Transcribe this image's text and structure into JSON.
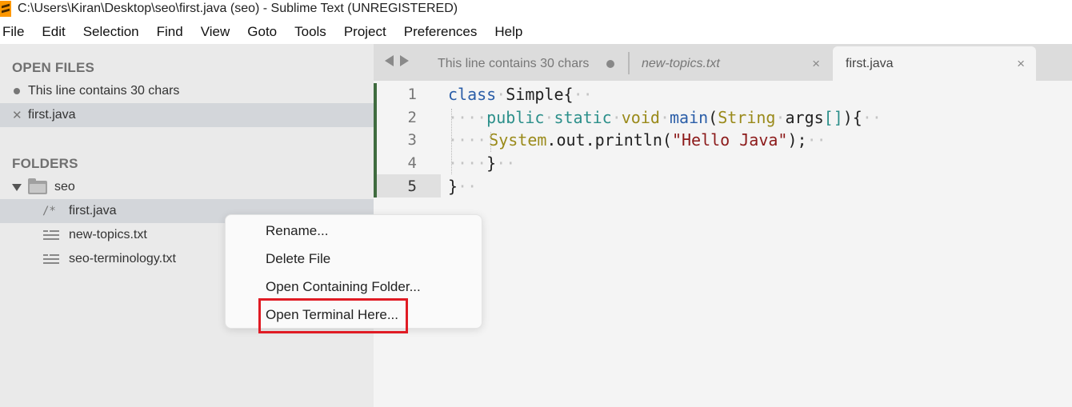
{
  "window": {
    "title": "C:\\Users\\Kiran\\Desktop\\seo\\first.java (seo) - Sublime Text (UNREGISTERED)"
  },
  "menubar": {
    "items": [
      "File",
      "Edit",
      "Selection",
      "Find",
      "View",
      "Goto",
      "Tools",
      "Project",
      "Preferences",
      "Help"
    ]
  },
  "sidebar": {
    "open_files_title": "OPEN FILES",
    "open_files": [
      {
        "label": "This line contains 30 chars",
        "state": "modified"
      },
      {
        "label": "first.java",
        "state": "active"
      }
    ],
    "folders_title": "FOLDERS",
    "folder": {
      "name": "seo",
      "expanded": true
    },
    "files": [
      {
        "glyph": "/*",
        "label": "first.java",
        "icon": "java-file-icon"
      },
      {
        "label": "new-topics.txt",
        "icon": "text-file-icon"
      },
      {
        "label": "seo-terminology.txt",
        "icon": "text-file-icon"
      }
    ]
  },
  "tabs": [
    {
      "label": "This line contains 30 chars",
      "dirty": true,
      "active": false
    },
    {
      "label": "new-topics.txt",
      "italic": true,
      "close": "×",
      "active": false
    },
    {
      "label": "first.java",
      "close": "×",
      "active": true
    }
  ],
  "editor": {
    "line_numbers": [
      "1",
      "2",
      "3",
      "4",
      "5"
    ],
    "current_line": 5,
    "code": {
      "l1_kw": "class",
      "l1_name": "Simple{",
      "l2_kw1": "public",
      "l2_kw2": "static",
      "l2_kw3": "void",
      "l2_fn": "main",
      "l2_paren": "(",
      "l2_type": "String",
      "l2_arg": "args",
      "l2_brk": "[]",
      "l2_end": "){",
      "l3_obj": "System",
      "l3_call": ".out.println(",
      "l3_str": "\"Hello Java\"",
      "l3_end": ");",
      "l4": "}",
      "l5": "}"
    }
  },
  "context_menu": {
    "items": [
      "Rename...",
      "Delete File",
      "Open Containing Folder...",
      "Open Terminal Here..."
    ],
    "highlighted_index": 3
  },
  "colors": {
    "highlight_border": "#e01b24",
    "sidebar_bg": "#eaeaea",
    "editor_bg": "#f4f4f4",
    "app_icon": "#ff9800"
  }
}
